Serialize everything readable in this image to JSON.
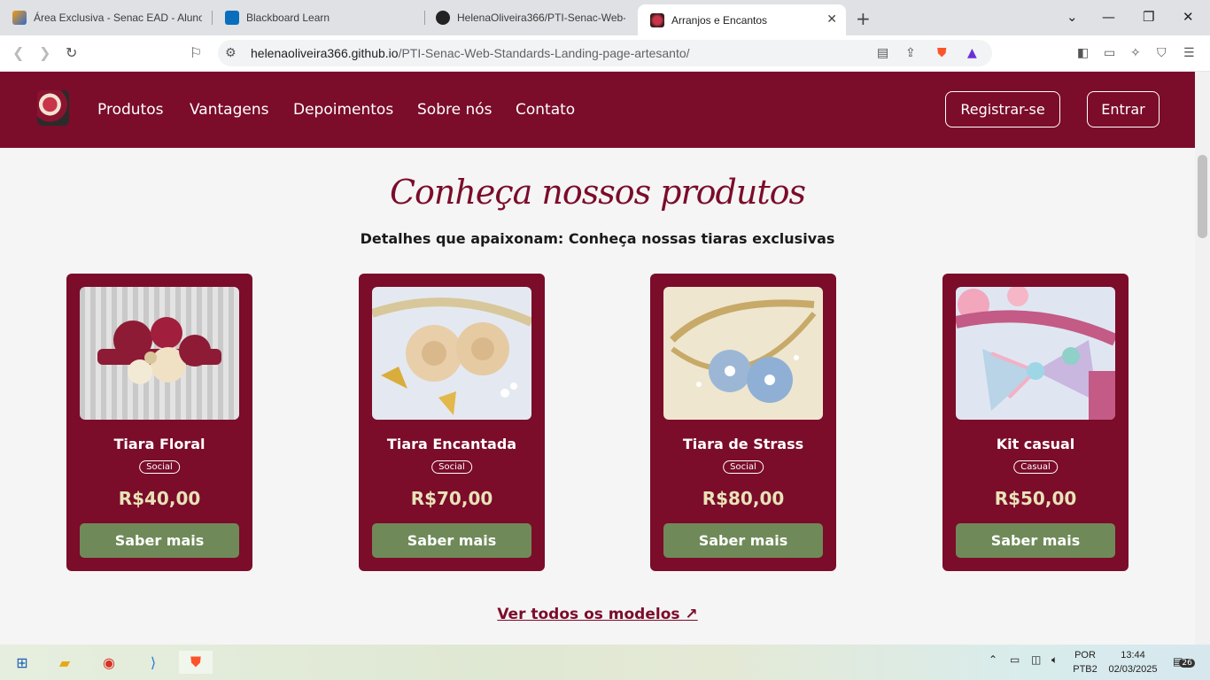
{
  "browser": {
    "tabs": [
      {
        "title": "Área Exclusiva - Senac EAD - Aluno",
        "active": false
      },
      {
        "title": "Blackboard Learn",
        "active": false
      },
      {
        "title": "HelenaOliveira366/PTI-Senac-Web-S",
        "active": false
      },
      {
        "title": "Arranjos e Encantos",
        "active": true
      }
    ],
    "url_host": "helenaoliveira366.github.io",
    "url_path": "/PTI-Senac-Web-Standards-Landing-page-artesanto/"
  },
  "site": {
    "nav": [
      "Produtos",
      "Vantagens",
      "Depoimentos",
      "Sobre nós",
      "Contato"
    ],
    "register_label": "Registrar-se",
    "login_label": "Entrar",
    "section_title": "Conheça nossos produtos",
    "section_subtitle": "Detalhes que apaixonam: Conheça nossas tiaras exclusivas",
    "products": [
      {
        "name": "Tiara Floral",
        "tag": "Social",
        "price": "R$40,00",
        "button": "Saber mais"
      },
      {
        "name": "Tiara Encantada",
        "tag": "Social",
        "price": "R$70,00",
        "button": "Saber mais"
      },
      {
        "name": "Tiara de Strass",
        "tag": "Social",
        "price": "R$80,00",
        "button": "Saber mais"
      },
      {
        "name": "Kit casual",
        "tag": "Casual",
        "price": "R$50,00",
        "button": "Saber mais"
      }
    ],
    "see_all_label": "Ver todos os modelos",
    "colors": {
      "brand": "#7b0c2a",
      "button_green": "#6f8a58",
      "price": "#e8e3b8"
    }
  },
  "taskbar": {
    "lang_top": "POR",
    "lang_bottom": "PTB2",
    "time": "13:44",
    "date": "02/03/2025",
    "notifications": "26"
  }
}
